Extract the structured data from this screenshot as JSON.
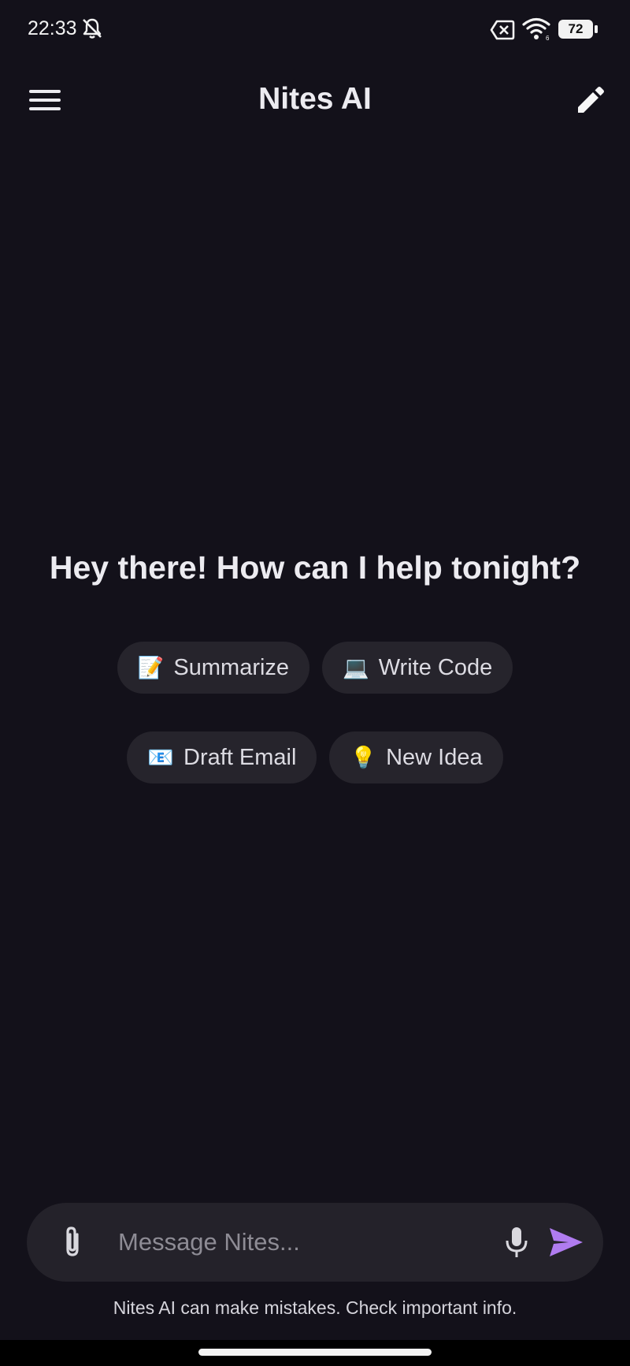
{
  "status_bar": {
    "time": "22:33",
    "battery_level": "72",
    "icons": [
      "bell-off-icon",
      "sim-x-icon",
      "wifi-icon",
      "battery-icon"
    ]
  },
  "app_bar": {
    "title": "Nites AI",
    "menu_icon": "hamburger-menu-icon",
    "edit_icon": "pencil-icon"
  },
  "greeting": "Hey there! How can I help tonight?",
  "suggestions": [
    {
      "emoji": "📝",
      "label": "Summarize"
    },
    {
      "emoji": "💻",
      "label": "Write Code"
    },
    {
      "emoji": "📧",
      "label": "Draft Email"
    },
    {
      "emoji": "💡",
      "label": "New Idea"
    }
  ],
  "composer": {
    "placeholder": "Message Nites...",
    "value": "",
    "icons": [
      "paperclip-icon",
      "microphone-icon",
      "send-icon"
    ]
  },
  "disclaimer": "Nites AI can make mistakes. Check important info.",
  "colors": {
    "background": "#13111a",
    "chip_background": "#26242c",
    "composer_background": "#24222a",
    "send_accent": "#b07cf0"
  }
}
